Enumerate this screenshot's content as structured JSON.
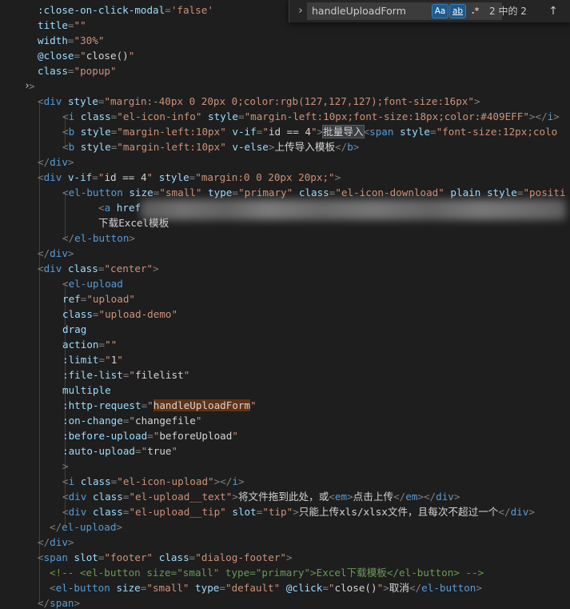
{
  "editor": {
    "lines": [
      [
        [
          "attr",
          ":close-on-click-modal"
        ],
        [
          "punc",
          "="
        ],
        [
          "str",
          "'false'"
        ]
      ],
      [
        [
          "attr",
          "title"
        ],
        [
          "punc",
          "="
        ],
        [
          "str",
          "\"\""
        ]
      ],
      [
        [
          "attr",
          "width"
        ],
        [
          "punc",
          "="
        ],
        [
          "str",
          "\"30%\""
        ]
      ],
      [
        [
          "attr",
          "@close"
        ],
        [
          "punc",
          "="
        ],
        [
          "str",
          "\""
        ],
        [
          "txt",
          "close()"
        ],
        [
          "str",
          "\""
        ]
      ],
      [
        [
          "attr",
          "class"
        ],
        [
          "punc",
          "="
        ],
        [
          "str",
          "\"popup\""
        ]
      ],
      [
        [
          "punc",
          ">"
        ]
      ],
      [
        [
          "punc",
          "<"
        ],
        [
          "tag",
          "div"
        ],
        [
          "txt",
          " "
        ],
        [
          "attr",
          "style"
        ],
        [
          "punc",
          "="
        ],
        [
          "str",
          "\"margin:-40px 0 20px 0;color:rgb(127,127,127);font-size:16px\""
        ],
        [
          "punc",
          ">"
        ]
      ],
      [
        [
          "punc",
          "<"
        ],
        [
          "tag",
          "i"
        ],
        [
          "txt",
          " "
        ],
        [
          "attr",
          "class"
        ],
        [
          "punc",
          "="
        ],
        [
          "str",
          "\"el-icon-info\""
        ],
        [
          "txt",
          " "
        ],
        [
          "attr",
          "style"
        ],
        [
          "punc",
          "="
        ],
        [
          "str",
          "\"margin-left:10px;font-size:18px;color:#409EFF\""
        ],
        [
          "punc",
          "></"
        ],
        [
          "tag",
          "i"
        ],
        [
          "punc",
          ">"
        ]
      ],
      [
        [
          "punc",
          "<"
        ],
        [
          "tag",
          "b"
        ],
        [
          "txt",
          " "
        ],
        [
          "attr",
          "style"
        ],
        [
          "punc",
          "="
        ],
        [
          "str",
          "\"margin-left:10px\""
        ],
        [
          "txt",
          " "
        ],
        [
          "attr",
          "v-if"
        ],
        [
          "punc",
          "="
        ],
        [
          "str",
          "\""
        ],
        [
          "txt",
          "id == 4"
        ],
        [
          "str",
          "\""
        ],
        [
          "punc",
          ">"
        ],
        [
          "hlsel",
          "批量导入"
        ],
        [
          "punc",
          "<"
        ],
        [
          "tag",
          "span"
        ],
        [
          "txt",
          " "
        ],
        [
          "attr",
          "style"
        ],
        [
          "punc",
          "="
        ],
        [
          "str",
          "\"font-size:12px;colo"
        ]
      ],
      [
        [
          "punc",
          "<"
        ],
        [
          "tag",
          "b"
        ],
        [
          "txt",
          " "
        ],
        [
          "attr",
          "style"
        ],
        [
          "punc",
          "="
        ],
        [
          "str",
          "\"margin-left:10px\""
        ],
        [
          "txt",
          " "
        ],
        [
          "attr",
          "v-else"
        ],
        [
          "punc",
          ">"
        ],
        [
          "txt",
          "上传导入模板"
        ],
        [
          "punc",
          "</"
        ],
        [
          "tag",
          "b"
        ],
        [
          "punc",
          ">"
        ]
      ],
      [
        [
          "punc",
          "</"
        ],
        [
          "tag",
          "div"
        ],
        [
          "punc",
          ">"
        ]
      ],
      [
        [
          "punc",
          "<"
        ],
        [
          "tag",
          "div"
        ],
        [
          "txt",
          " "
        ],
        [
          "attr",
          "v-if"
        ],
        [
          "punc",
          "="
        ],
        [
          "str",
          "\""
        ],
        [
          "txt",
          "id == 4"
        ],
        [
          "str",
          "\""
        ],
        [
          "txt",
          " "
        ],
        [
          "attr",
          "style"
        ],
        [
          "punc",
          "="
        ],
        [
          "str",
          "\"margin:0 0 20px 20px;\""
        ],
        [
          "punc",
          ">"
        ]
      ],
      [
        [
          "punc",
          "<"
        ],
        [
          "tag",
          "el-button"
        ],
        [
          "txt",
          " "
        ],
        [
          "attr",
          "size"
        ],
        [
          "punc",
          "="
        ],
        [
          "str",
          "\"small\""
        ],
        [
          "txt",
          " "
        ],
        [
          "attr",
          "type"
        ],
        [
          "punc",
          "="
        ],
        [
          "str",
          "\"primary\""
        ],
        [
          "txt",
          " "
        ],
        [
          "attr",
          "class"
        ],
        [
          "punc",
          "="
        ],
        [
          "str",
          "\"el-icon-download\""
        ],
        [
          "txt",
          " "
        ],
        [
          "attr",
          "plain"
        ],
        [
          "txt",
          " "
        ],
        [
          "attr",
          "style"
        ],
        [
          "punc",
          "="
        ],
        [
          "str",
          "\"positi"
        ]
      ],
      [
        [
          "punc",
          "<"
        ],
        [
          "tag",
          "a"
        ],
        [
          "txt",
          " "
        ],
        [
          "attr",
          "href"
        ]
      ],
      [
        [
          "txt",
          "下载Excel模板"
        ]
      ],
      [
        [
          "punc",
          "</"
        ],
        [
          "tag",
          "el-button"
        ],
        [
          "punc",
          ">"
        ]
      ],
      [
        [
          "punc",
          "</"
        ],
        [
          "tag",
          "div"
        ],
        [
          "punc",
          ">"
        ]
      ],
      [
        [
          "punc",
          "<"
        ],
        [
          "tag",
          "div"
        ],
        [
          "txt",
          " "
        ],
        [
          "attr",
          "class"
        ],
        [
          "punc",
          "="
        ],
        [
          "str",
          "\"center\""
        ],
        [
          "punc",
          ">"
        ]
      ],
      [
        [
          "punc",
          "<"
        ],
        [
          "tag",
          "el-upload"
        ]
      ],
      [
        [
          "attr",
          "ref"
        ],
        [
          "punc",
          "="
        ],
        [
          "str",
          "\"upload\""
        ]
      ],
      [
        [
          "attr",
          "class"
        ],
        [
          "punc",
          "="
        ],
        [
          "str",
          "\"upload-demo\""
        ]
      ],
      [
        [
          "attr",
          "drag"
        ]
      ],
      [
        [
          "attr",
          "action"
        ],
        [
          "punc",
          "="
        ],
        [
          "str",
          "\"\""
        ]
      ],
      [
        [
          "attr",
          ":limit"
        ],
        [
          "punc",
          "="
        ],
        [
          "str",
          "\""
        ],
        [
          "txt",
          "1"
        ],
        [
          "str",
          "\""
        ]
      ],
      [
        [
          "attr",
          ":file-list"
        ],
        [
          "punc",
          "="
        ],
        [
          "str",
          "\""
        ],
        [
          "txt",
          "filelist"
        ],
        [
          "str",
          "\""
        ]
      ],
      [
        [
          "attr",
          "multiple"
        ]
      ],
      [
        [
          "attr",
          ":http-request"
        ],
        [
          "punc",
          "="
        ],
        [
          "str",
          "\""
        ],
        [
          "hl",
          "handleUploadForm"
        ],
        [
          "str",
          "\""
        ]
      ],
      [
        [
          "attr",
          ":on-change"
        ],
        [
          "punc",
          "="
        ],
        [
          "str",
          "\""
        ],
        [
          "txt",
          "changefile"
        ],
        [
          "str",
          "\""
        ]
      ],
      [
        [
          "attr",
          ":before-upload"
        ],
        [
          "punc",
          "="
        ],
        [
          "str",
          "\""
        ],
        [
          "txt",
          "beforeUpload"
        ],
        [
          "str",
          "\""
        ]
      ],
      [
        [
          "attr",
          ":auto-upload"
        ],
        [
          "punc",
          "="
        ],
        [
          "str",
          "\""
        ],
        [
          "txt",
          "true"
        ],
        [
          "str",
          "\""
        ]
      ],
      [
        [
          "punc",
          ">"
        ]
      ],
      [
        [
          "punc",
          "<"
        ],
        [
          "tag",
          "i"
        ],
        [
          "txt",
          " "
        ],
        [
          "attr",
          "class"
        ],
        [
          "punc",
          "="
        ],
        [
          "str",
          "\"el-icon-upload\""
        ],
        [
          "punc",
          "></"
        ],
        [
          "tag",
          "i"
        ],
        [
          "punc",
          ">"
        ]
      ],
      [
        [
          "punc",
          "<"
        ],
        [
          "tag",
          "div"
        ],
        [
          "txt",
          " "
        ],
        [
          "attr",
          "class"
        ],
        [
          "punc",
          "="
        ],
        [
          "str",
          "\"el-upload__text\""
        ],
        [
          "punc",
          ">"
        ],
        [
          "txt",
          "将文件拖到此处，或"
        ],
        [
          "punc",
          "<"
        ],
        [
          "tag",
          "em"
        ],
        [
          "punc",
          ">"
        ],
        [
          "txt",
          "点击上传"
        ],
        [
          "punc",
          "</"
        ],
        [
          "tag",
          "em"
        ],
        [
          "punc",
          "></"
        ],
        [
          "tag",
          "div"
        ],
        [
          "punc",
          ">"
        ]
      ],
      [
        [
          "punc",
          "<"
        ],
        [
          "tag",
          "div"
        ],
        [
          "txt",
          " "
        ],
        [
          "attr",
          "class"
        ],
        [
          "punc",
          "="
        ],
        [
          "str",
          "\"el-upload__tip\""
        ],
        [
          "txt",
          " "
        ],
        [
          "attr",
          "slot"
        ],
        [
          "punc",
          "="
        ],
        [
          "str",
          "\"tip\""
        ],
        [
          "punc",
          ">"
        ],
        [
          "txt",
          "只能上传xls/xlsx文件，且每次不超过一个"
        ],
        [
          "punc",
          "</"
        ],
        [
          "tag",
          "div"
        ],
        [
          "punc",
          ">"
        ]
      ],
      [
        [
          "punc",
          "</"
        ],
        [
          "tag",
          "el-upload"
        ],
        [
          "punc",
          ">"
        ]
      ],
      [
        [
          "punc",
          "</"
        ],
        [
          "tag",
          "div"
        ],
        [
          "punc",
          ">"
        ]
      ],
      [
        [
          "punc",
          "<"
        ],
        [
          "tag",
          "span"
        ],
        [
          "txt",
          " "
        ],
        [
          "attr",
          "slot"
        ],
        [
          "punc",
          "="
        ],
        [
          "str",
          "\"footer\""
        ],
        [
          "txt",
          " "
        ],
        [
          "attr",
          "class"
        ],
        [
          "punc",
          "="
        ],
        [
          "str",
          "\"dialog-footer\""
        ],
        [
          "punc",
          ">"
        ]
      ],
      [
        [
          "cmt",
          "<!-- <el-button size=\"small\" type=\"primary\">Excel下载模板</el-button> -->"
        ]
      ],
      [
        [
          "punc",
          "<"
        ],
        [
          "tag",
          "el-button"
        ],
        [
          "txt",
          " "
        ],
        [
          "attr",
          "size"
        ],
        [
          "punc",
          "="
        ],
        [
          "str",
          "\"small\""
        ],
        [
          "txt",
          " "
        ],
        [
          "attr",
          "type"
        ],
        [
          "punc",
          "="
        ],
        [
          "str",
          "\"default\""
        ],
        [
          "txt",
          " "
        ],
        [
          "attr",
          "@click"
        ],
        [
          "punc",
          "="
        ],
        [
          "str",
          "\""
        ],
        [
          "txt",
          "close()"
        ],
        [
          "str",
          "\""
        ],
        [
          "punc",
          ">"
        ],
        [
          "txt",
          "取消"
        ],
        [
          "punc",
          "</"
        ],
        [
          "tag",
          "el-button"
        ],
        [
          "punc",
          ">"
        ]
      ],
      [
        [
          "punc",
          "</"
        ],
        [
          "tag",
          "span"
        ],
        [
          "punc",
          ">"
        ]
      ]
    ]
  },
  "find": {
    "query": "handleUploadForm",
    "match_case_label": "Aa",
    "whole_word_label": "ab",
    "regex_label": ".*",
    "count": "2 中的 2",
    "prev_arrow": "↑"
  },
  "icons": {
    "chevron": "chevron-right-icon"
  }
}
